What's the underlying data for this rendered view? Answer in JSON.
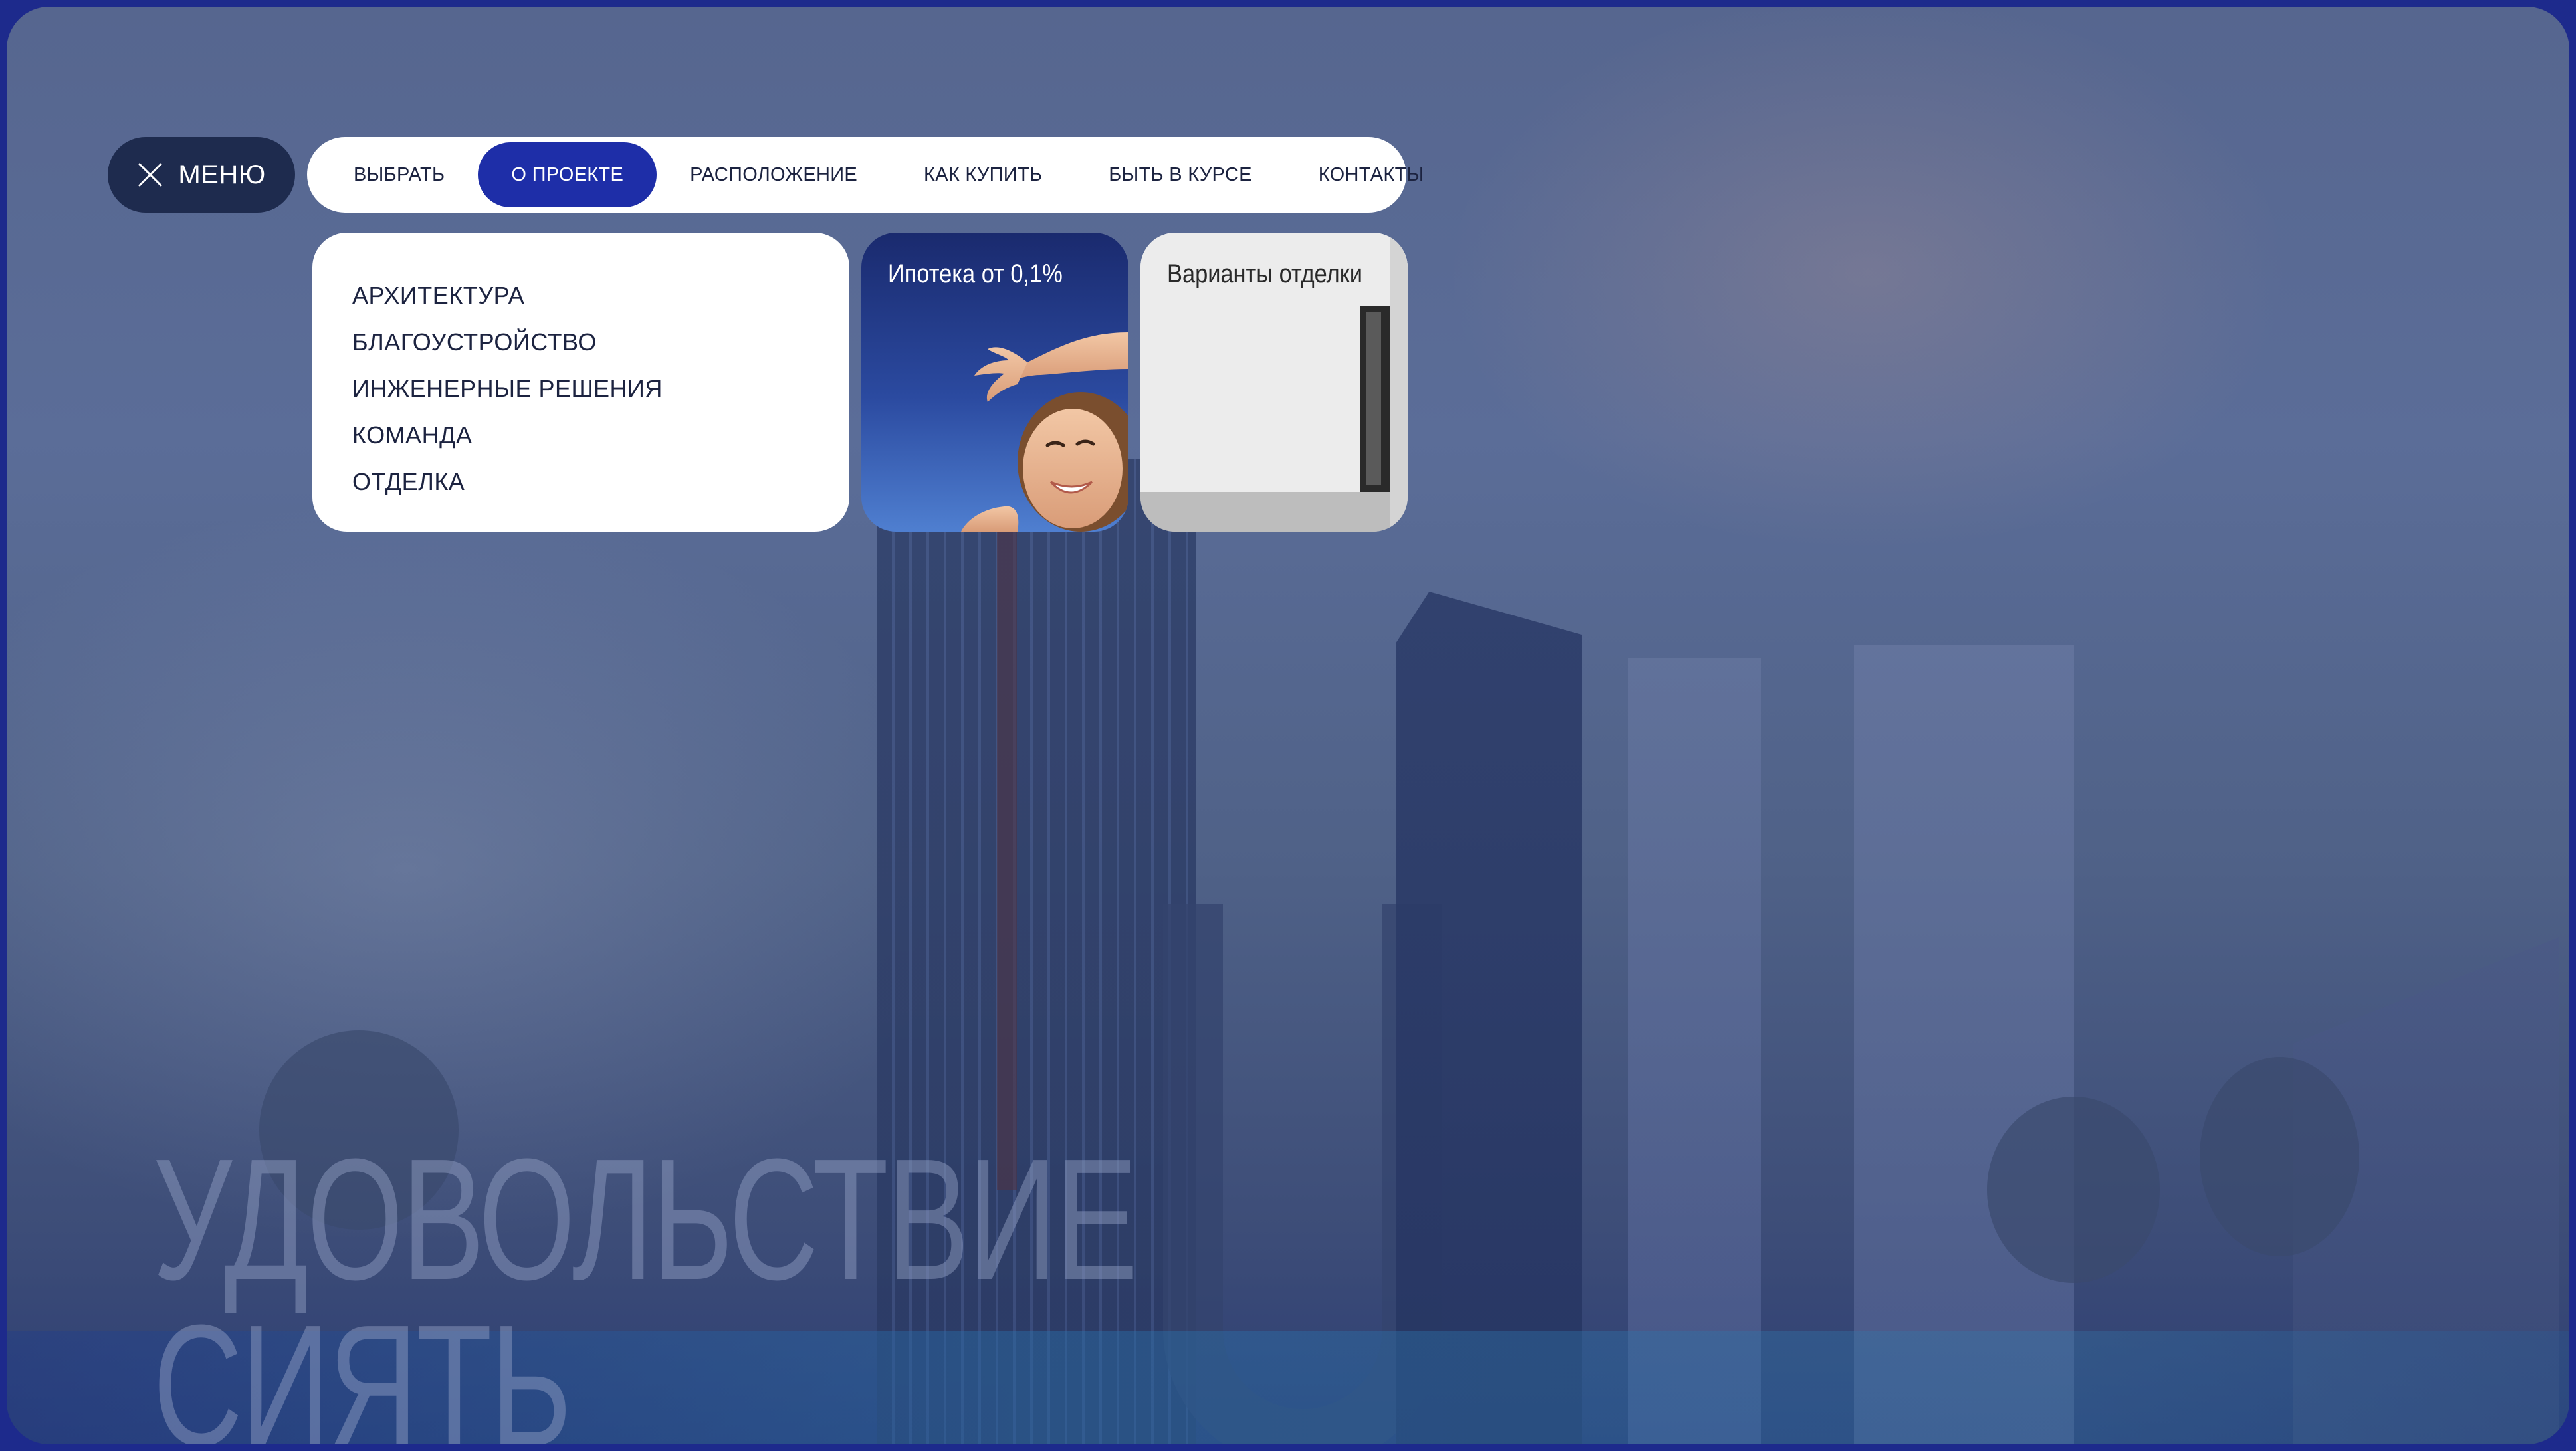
{
  "menu_button": {
    "label": "МЕНЮ"
  },
  "nav": {
    "items": [
      {
        "label": "ВЫБРАТЬ",
        "active": false
      },
      {
        "label": "О ПРОЕКТЕ",
        "active": true
      },
      {
        "label": "РАСПОЛОЖЕНИЕ",
        "active": false
      },
      {
        "label": "КАК КУПИТЬ",
        "active": false
      },
      {
        "label": "БЫТЬ В КУРСЕ",
        "active": false
      },
      {
        "label": "КОНТАКТЫ",
        "active": false
      }
    ]
  },
  "submenu": {
    "items": [
      "АРХИТЕКТУРА",
      "БЛАГОУСТРОЙСТВО",
      "ИНЖЕНЕРНЫЕ РЕШЕНИЯ",
      "КОМАНДА",
      "ОТДЕЛКА"
    ]
  },
  "promos": {
    "mortgage": {
      "title": "Ипотека от 0,1%"
    },
    "finish": {
      "title": "Варианты отделки"
    }
  },
  "hero": {
    "line1": "УДОВОЛЬСТВИЕ",
    "line2": "СИЯТЬ"
  },
  "colors": {
    "accent": "#1e2ea8",
    "menu_button_bg": "#1e2b4e",
    "frame": "#1d2a8c"
  }
}
